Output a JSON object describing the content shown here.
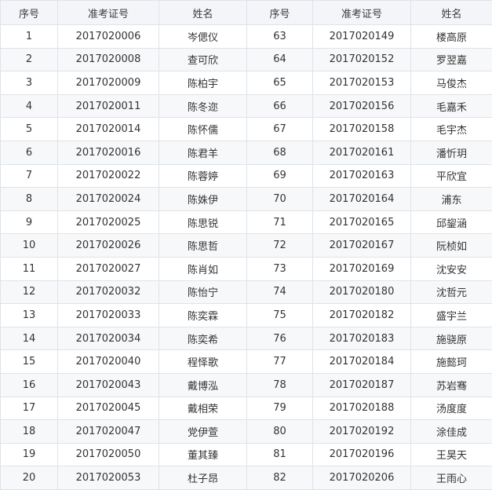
{
  "headers": [
    "序号",
    "准考证号",
    "姓名",
    "序号",
    "准考证号",
    "姓名"
  ],
  "rows": [
    [
      "1",
      "2017020006",
      "岑偲仪",
      "63",
      "2017020149",
      "楼高原"
    ],
    [
      "2",
      "2017020008",
      "查可欣",
      "64",
      "2017020152",
      "罗翌嘉"
    ],
    [
      "3",
      "2017020009",
      "陈柏宇",
      "65",
      "2017020153",
      "马俊杰"
    ],
    [
      "4",
      "2017020011",
      "陈冬迩",
      "66",
      "2017020156",
      "毛嘉禾"
    ],
    [
      "5",
      "2017020014",
      "陈怀儒",
      "67",
      "2017020158",
      "毛宇杰"
    ],
    [
      "6",
      "2017020016",
      "陈君羊",
      "68",
      "2017020161",
      "潘忻玥"
    ],
    [
      "7",
      "2017020022",
      "陈蓉婷",
      "69",
      "2017020163",
      "平欣宜"
    ],
    [
      "8",
      "2017020024",
      "陈姝伊",
      "70",
      "2017020164",
      "浦东"
    ],
    [
      "9",
      "2017020025",
      "陈思锐",
      "71",
      "2017020165",
      "邱鋆涵"
    ],
    [
      "10",
      "2017020026",
      "陈思哲",
      "72",
      "2017020167",
      "阮桢如"
    ],
    [
      "11",
      "2017020027",
      "陈肖如",
      "73",
      "2017020169",
      "沈安安"
    ],
    [
      "12",
      "2017020032",
      "陈怡宁",
      "74",
      "2017020180",
      "沈哲元"
    ],
    [
      "13",
      "2017020033",
      "陈奕霖",
      "75",
      "2017020182",
      "盛宇兰"
    ],
    [
      "14",
      "2017020034",
      "陈奕希",
      "76",
      "2017020183",
      "施骁原"
    ],
    [
      "15",
      "2017020040",
      "程怿歌",
      "77",
      "2017020184",
      "施懿珂"
    ],
    [
      "16",
      "2017020043",
      "戴博泓",
      "78",
      "2017020187",
      "苏岩骞"
    ],
    [
      "17",
      "2017020045",
      "戴相荣",
      "79",
      "2017020188",
      "汤度度"
    ],
    [
      "18",
      "2017020047",
      "党伊萱",
      "80",
      "2017020192",
      "涂佳成"
    ],
    [
      "19",
      "2017020050",
      "董其臻",
      "81",
      "2017020196",
      "王昊天"
    ],
    [
      "20",
      "2017020053",
      "杜子昂",
      "82",
      "2017020206",
      "王雨心"
    ]
  ]
}
